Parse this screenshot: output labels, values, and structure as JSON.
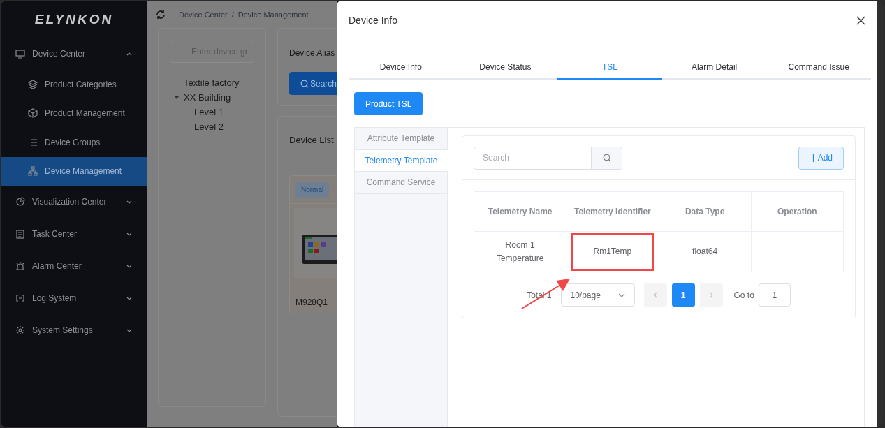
{
  "sidebar": {
    "logo": "ELYNKON",
    "items": [
      {
        "label": "Device Center",
        "expanded": true,
        "children": [
          {
            "label": "Product Categories",
            "selected": false
          },
          {
            "label": "Product Management",
            "selected": false
          },
          {
            "label": "Device Groups",
            "selected": false
          },
          {
            "label": "Device Management",
            "selected": true
          }
        ]
      },
      {
        "label": "Visualization Center",
        "expanded": false
      },
      {
        "label": "Task Center",
        "expanded": false
      },
      {
        "label": "Alarm Center",
        "expanded": false
      },
      {
        "label": "Log System",
        "expanded": false
      },
      {
        "label": "System Settings",
        "expanded": false
      }
    ]
  },
  "breadcrumb": {
    "separator": "/",
    "items": [
      "Device Center",
      "Device Management"
    ]
  },
  "group_panel": {
    "search": {
      "placeholder": "Enter device gr"
    },
    "tree": [
      {
        "label": "Textile factory"
      },
      {
        "label": "XX Building",
        "expanded": true,
        "children": [
          {
            "label": "Level 1"
          },
          {
            "label": "Level 2"
          }
        ]
      }
    ]
  },
  "filter": {
    "label": "Device Alias",
    "search_button": "Search"
  },
  "device_list": {
    "title": "Device List",
    "cards": [
      {
        "status": "Normal",
        "name": "M928Q1"
      }
    ]
  },
  "drawer": {
    "title": "Device Info",
    "tabs": [
      {
        "label": "Device Info",
        "selected": false
      },
      {
        "label": "Device Status",
        "selected": false
      },
      {
        "label": "TSL",
        "selected": true
      },
      {
        "label": "Alarm Detail",
        "selected": false
      },
      {
        "label": "Command Issue",
        "selected": false
      }
    ],
    "product_button": "Product TSL",
    "side_tabs": [
      {
        "label": "Attribute Template",
        "selected": false
      },
      {
        "label": "Telemetry Template",
        "selected": true
      },
      {
        "label": "Command Service",
        "selected": false
      }
    ],
    "search": {
      "placeholder": "Search"
    },
    "add_button": "Add",
    "table": {
      "columns": [
        "Telemetry Name",
        "Telemetry Identifier",
        "Data Type",
        "Operation"
      ],
      "rows": [
        {
          "cells": [
            {
              "text": "Room 1 Temperature",
              "highlighted": false
            },
            {
              "text": "Rm1Temp",
              "highlighted": true
            },
            {
              "text": "float64",
              "highlighted": false
            },
            {
              "highlighted": false
            }
          ]
        }
      ]
    },
    "pagination": {
      "total": "Total 1",
      "page_size": "10/page",
      "pages": [
        {
          "label": "1",
          "selected": true
        }
      ],
      "goto_label": "Go to",
      "goto_value": "1"
    }
  }
}
